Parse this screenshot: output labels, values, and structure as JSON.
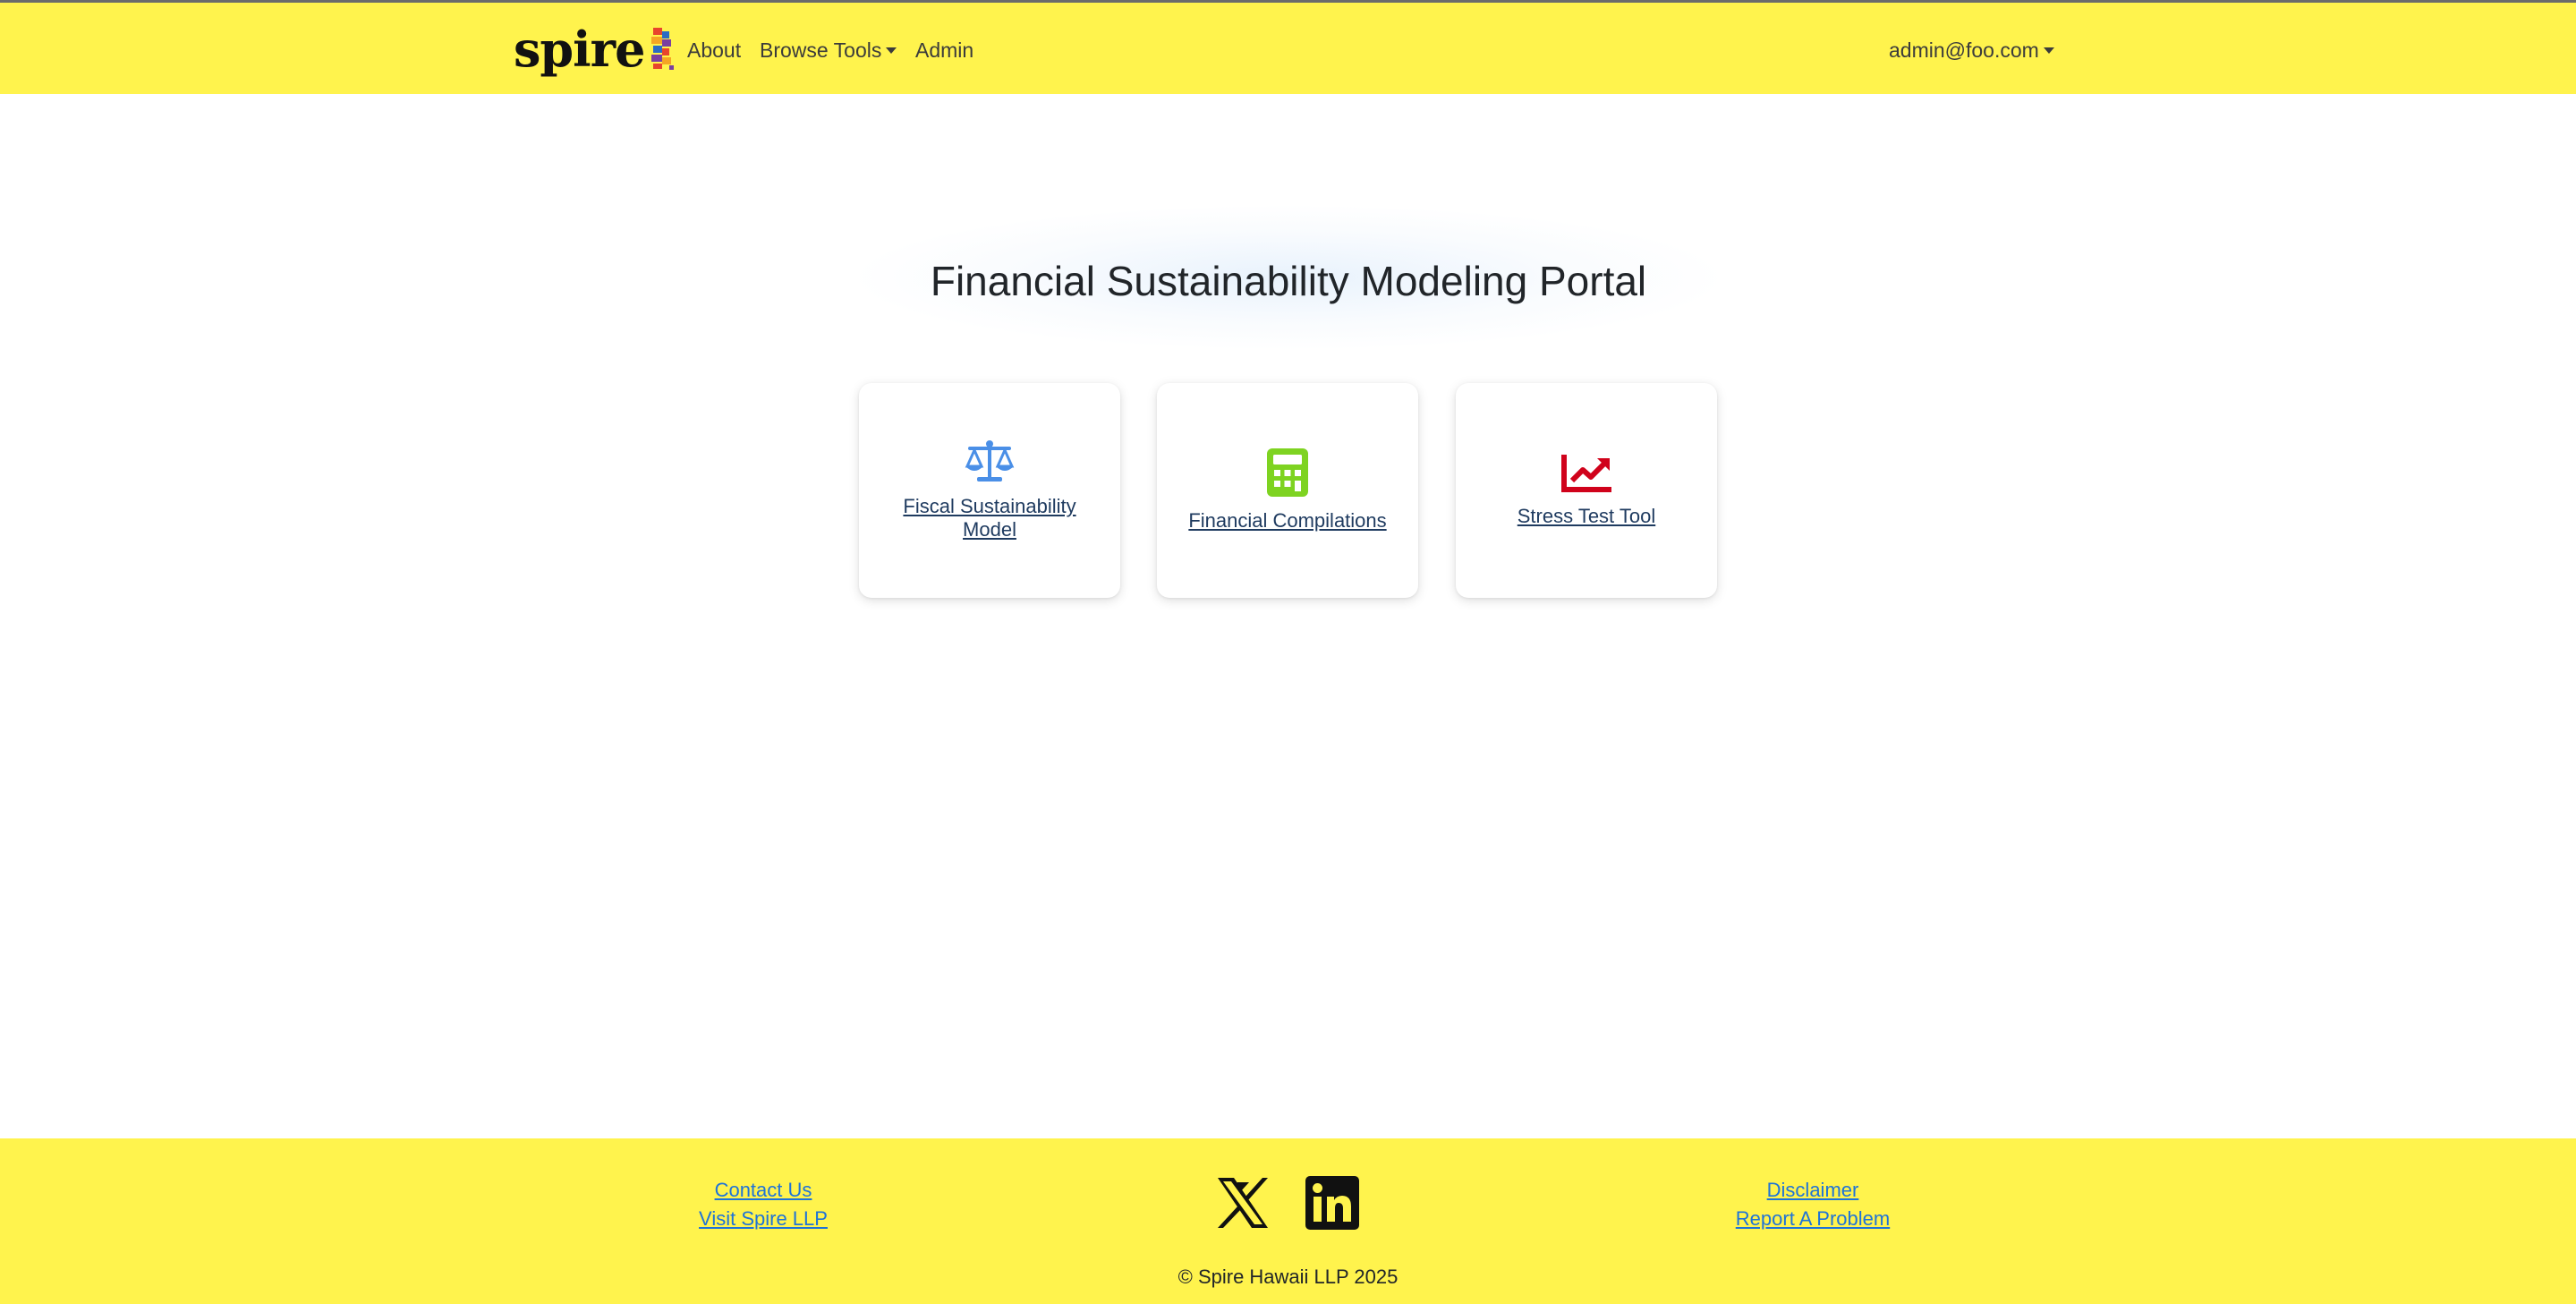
{
  "navbar": {
    "brand": "spire",
    "links": {
      "about": "About",
      "browse_tools": "Browse Tools",
      "admin": "Admin"
    },
    "user": "admin@foo.com"
  },
  "main": {
    "title": "Financial Sustainability Modeling Portal",
    "cards": [
      {
        "label": "Fiscal Sustainability Model",
        "icon": "scale-balance-icon",
        "color": "#4a8fe7"
      },
      {
        "label": "Financial Compilations",
        "icon": "calculator-icon",
        "color": "#7ed321"
      },
      {
        "label": "Stress Test Tool",
        "icon": "chart-line-up-icon",
        "color": "#d0021b"
      }
    ]
  },
  "footer": {
    "left_links": [
      "Contact Us",
      "Visit Spire LLP"
    ],
    "right_links": [
      "Disclaimer",
      "Report A Problem"
    ],
    "social": [
      "x-icon",
      "linkedin-icon"
    ],
    "copyright": "© Spire Hawaii LLP 2025"
  },
  "colors": {
    "brand_yellow": "#fff34d",
    "link_blue": "#1e73d8",
    "card_link": "#1e3a5f"
  }
}
